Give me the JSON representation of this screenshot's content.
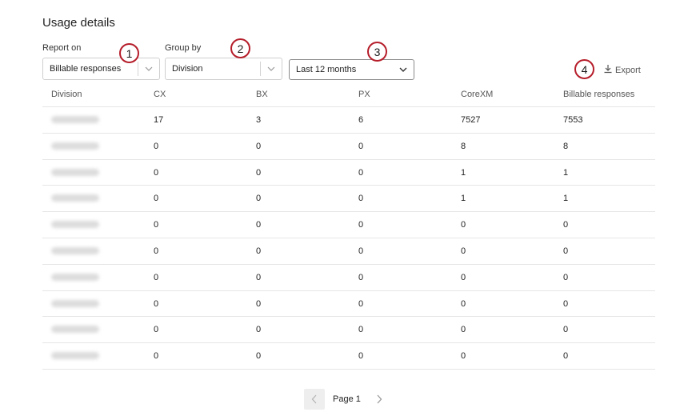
{
  "page": {
    "title": "Usage details"
  },
  "filters": {
    "report_on": {
      "label": "Report on",
      "value": "Billable responses",
      "badge": "1"
    },
    "group_by": {
      "label": "Group by",
      "value": "Division",
      "badge": "2"
    },
    "date_range": {
      "value": "Last 12 months",
      "badge": "3"
    },
    "export": {
      "label": "Export",
      "badge": "4"
    }
  },
  "table": {
    "columns": [
      "Division",
      "CX",
      "BX",
      "PX",
      "CoreXM",
      "Billable responses"
    ],
    "rows": [
      [
        "17",
        "3",
        "6",
        "7527",
        "7553"
      ],
      [
        "0",
        "0",
        "0",
        "8",
        "8"
      ],
      [
        "0",
        "0",
        "0",
        "1",
        "1"
      ],
      [
        "0",
        "0",
        "0",
        "1",
        "1"
      ],
      [
        "0",
        "0",
        "0",
        "0",
        "0"
      ],
      [
        "0",
        "0",
        "0",
        "0",
        "0"
      ],
      [
        "0",
        "0",
        "0",
        "0",
        "0"
      ],
      [
        "0",
        "0",
        "0",
        "0",
        "0"
      ],
      [
        "0",
        "0",
        "0",
        "0",
        "0"
      ],
      [
        "0",
        "0",
        "0",
        "0",
        "0"
      ]
    ]
  },
  "pagination": {
    "label": "Page 1"
  },
  "colors": {
    "badge_border": "#b51d2a",
    "divider": "#e6e6e6"
  }
}
